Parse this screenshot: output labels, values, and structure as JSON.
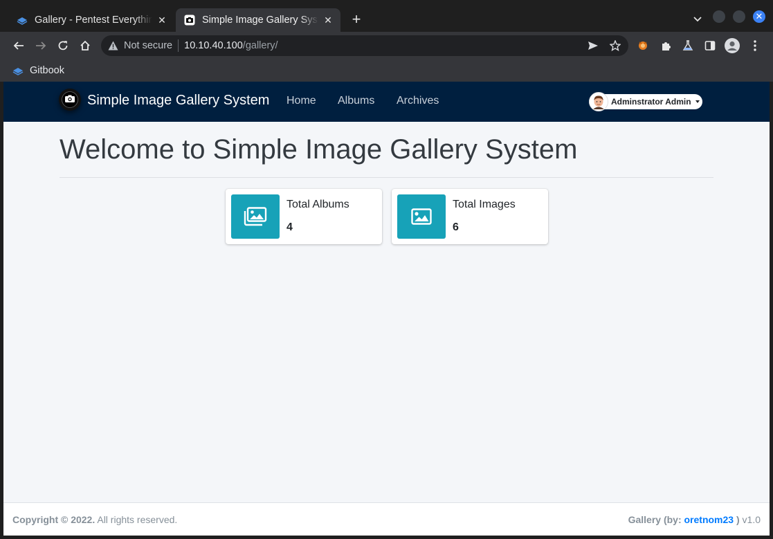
{
  "browser": {
    "tabs": [
      {
        "title": "Gallery - Pentest Everything",
        "active": false
      },
      {
        "title": "Simple Image Gallery System",
        "active": true
      }
    ],
    "address": {
      "security_label": "Not secure",
      "host": "10.10.40.100",
      "path": "/gallery/"
    },
    "bookmarks": [
      {
        "label": "Gitbook"
      }
    ],
    "accent_color": "#3b82f6"
  },
  "site": {
    "brand": "Simple Image Gallery System",
    "nav": [
      "Home",
      "Albums",
      "Archives"
    ],
    "user": "Adminstrator Admin",
    "navbar_color": "#001f3f"
  },
  "main": {
    "title": "Welcome to Simple Image Gallery System",
    "stats": [
      {
        "label": "Total Albums",
        "value": "4",
        "icon": "images-icon"
      },
      {
        "label": "Total Images",
        "value": "6",
        "icon": "image-icon"
      }
    ],
    "info_color": "#17a2b8"
  },
  "footer": {
    "copyright": "Copyright © 2022.",
    "rights": "All rights reserved.",
    "credit_prefix": "Gallery (by:",
    "author": "oretnom23",
    "credit_suffix": ")",
    "version": "v1.0"
  }
}
